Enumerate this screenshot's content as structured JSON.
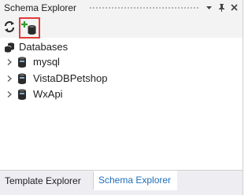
{
  "panel": {
    "title": "Schema Explorer",
    "title_buttons": [
      "dropdown-arrow-icon",
      "pin-icon",
      "close-icon"
    ]
  },
  "toolbar": {
    "buttons": [
      {
        "name": "refresh",
        "icon": "refresh-icon"
      },
      {
        "name": "add-database",
        "icon": "add-database-icon",
        "highlighted": true,
        "highlight_color": "#e23b3b"
      }
    ]
  },
  "tree": {
    "root": {
      "label": "Databases",
      "icon": "databases-icon"
    },
    "children": [
      {
        "label": "mysql",
        "icon": "database-icon"
      },
      {
        "label": "VistaDBPetshop",
        "icon": "database-icon"
      },
      {
        "label": "WxApi",
        "icon": "database-icon"
      }
    ]
  },
  "tabs": [
    {
      "label": "Template Explorer",
      "active": false
    },
    {
      "label": "Schema Explorer",
      "active": true
    }
  ],
  "colors": {
    "active_tab_text": "#1e6fb8",
    "highlight_border": "#e23b3b"
  }
}
